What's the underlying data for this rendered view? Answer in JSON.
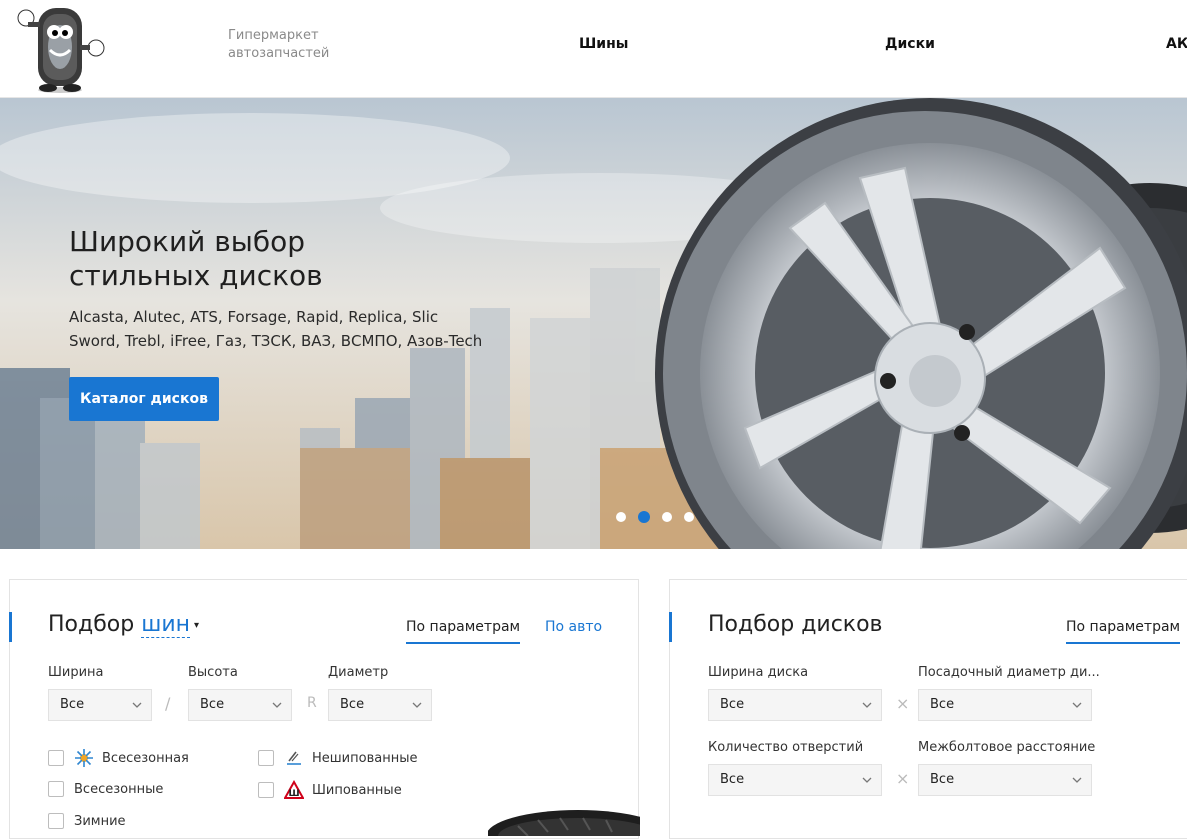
{
  "header": {
    "tagline": "Гипермаркет автозапчастей",
    "nav": [
      "Шины",
      "Диски",
      "АК"
    ]
  },
  "hero": {
    "title": "Широкий выбор стильных дисков",
    "brands": "Alcasta, Alutec, ATS, Forsage, Rapid, Replica, Slic Sword, Trebl, iFree, Газ, ТЗСК, ВАЗ, ВСМПО, Азов-Tech",
    "button": "Каталог дисков",
    "slides_total": 4,
    "active_slide": 2
  },
  "tire_panel": {
    "title_prefix": "Подбор",
    "title_link": "шин",
    "tabs": [
      "По параметрам",
      "По авто"
    ],
    "fields": {
      "width": {
        "label": "Ширина",
        "value": "Все"
      },
      "height": {
        "label": "Высота",
        "value": "Все"
      },
      "diameter": {
        "label": "Диаметр",
        "value": "Все"
      },
      "sep_slash": "/",
      "sep_r": "R"
    },
    "checks": {
      "allseason_icon": "Всесезонная",
      "allseason": "Всесезонные",
      "winter": "Зимние",
      "nonstudded": "Нешипованные",
      "studded": "Шипованные"
    }
  },
  "disk_panel": {
    "title": "Подбор дисков",
    "tab": "По параметрам",
    "fields": {
      "width": {
        "label": "Ширина диска",
        "value": "Все"
      },
      "seat_diameter": {
        "label": "Посадочный диаметр ди...",
        "value": "Все"
      },
      "holes": {
        "label": "Количество отверстий",
        "value": "Все"
      },
      "bolt_pattern": {
        "label": "Межболтовое расстояние",
        "value": "Все"
      },
      "sep_x": "×"
    }
  },
  "colors": {
    "accent": "#1976d2",
    "text": "#222222",
    "muted": "#8a8a8a"
  }
}
